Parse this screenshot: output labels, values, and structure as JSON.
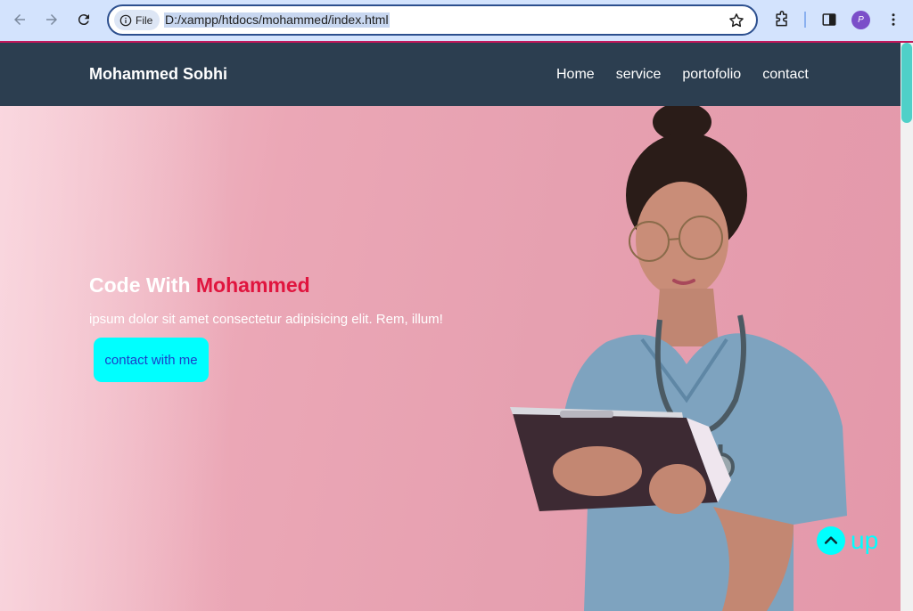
{
  "browser": {
    "site_chip": "File",
    "url": "D:/xampp/htdocs/mohammed/index.html",
    "profile_initial": "P"
  },
  "site": {
    "brand": "Mohammed Sobhi",
    "nav": [
      "Home",
      "service",
      "portofolio",
      "contact"
    ],
    "hero": {
      "title_start": "Code With ",
      "title_accent": "Mohammed",
      "text": "ipsum dolor sit amet consectetur adipisicing elit. Rem, illum!",
      "button": "contact with me"
    },
    "up_label": "up"
  },
  "colors": {
    "navbar": "#2c3e50",
    "accent": "#e0153e",
    "cta": "#00ffff",
    "hero_bg": "#e8a3b3"
  }
}
